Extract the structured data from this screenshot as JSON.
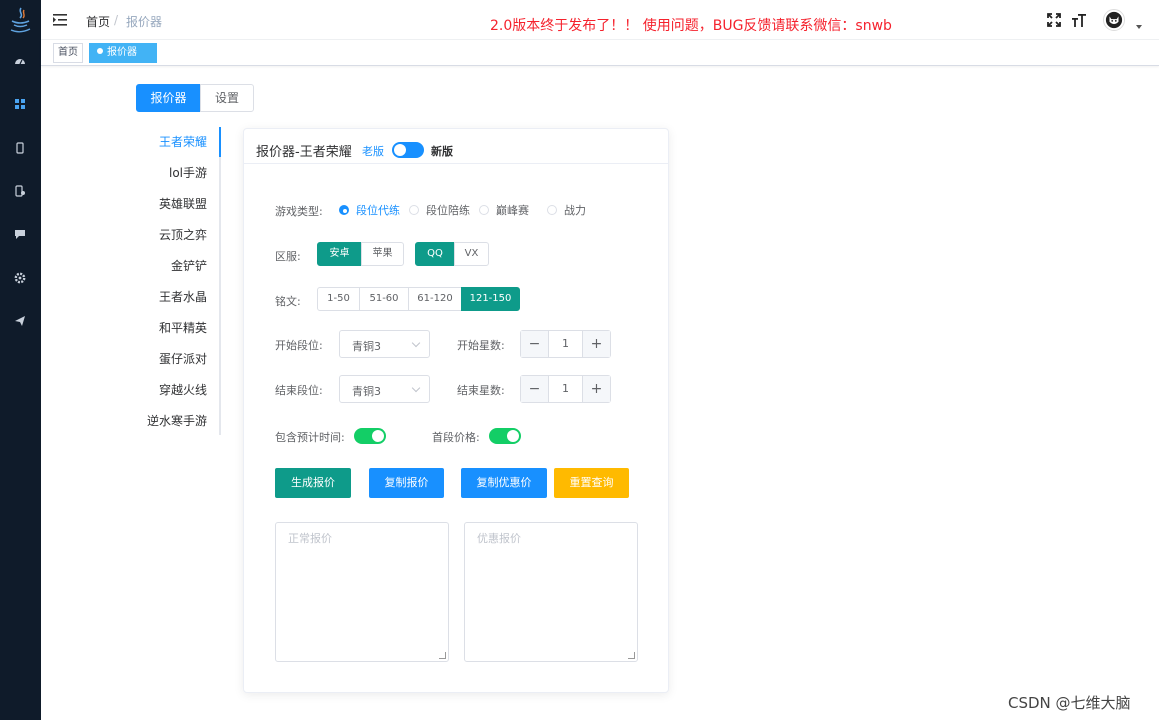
{
  "header": {
    "breadcrumb": [
      "首页",
      "/",
      "报价器"
    ],
    "announcement": "2.0版本终于发布了！！ 使用问题，BUG反馈请联系微信：snwb"
  },
  "sidebar": {
    "icons": [
      "dashboard-icon",
      "grid-icon",
      "mobile-icon",
      "mobile-tool-icon",
      "message-icon",
      "settings-icon",
      "send-icon"
    ]
  },
  "tags": {
    "home": "首页",
    "active": "报价器",
    "close": "×"
  },
  "top_tabs": [
    "报价器",
    "设置"
  ],
  "game_tabs": {
    "active_index": 0,
    "items": [
      "王者荣耀",
      "lol手游",
      "英雄联盟",
      "云顶之弈",
      "金铲铲",
      "王者水晶",
      "和平精英",
      "蛋仔派对",
      "穿越火线",
      "逆水寒手游"
    ]
  },
  "card": {
    "title": "报价器-王者荣耀",
    "old_label": "老版",
    "new_label": "新版"
  },
  "form": {
    "game_type_label": "游戏类型:",
    "game_types": [
      "段位代练",
      "段位陪练",
      "巅峰赛",
      "战力"
    ],
    "game_type_selected": 0,
    "region_label": "区服:",
    "platform": [
      "安卓",
      "苹果"
    ],
    "platform_selected": 0,
    "account": [
      "QQ",
      "VX"
    ],
    "account_selected": 0,
    "inscription_label": "铭文:",
    "inscriptions": [
      "1-50",
      "51-60",
      "61-120",
      "121-150"
    ],
    "inscription_selected": 3,
    "start_rank_label": "开始段位:",
    "start_rank_value": "青铜3",
    "start_stars_label": "开始星数:",
    "start_stars_value": "1",
    "end_rank_label": "结束段位:",
    "end_rank_value": "青铜3",
    "end_stars_label": "结束星数:",
    "end_stars_value": "1",
    "minus": "−",
    "plus": "+",
    "include_time_label": "包含预计时间:",
    "include_time_on": true,
    "first_price_label": "首段价格:",
    "first_price_on": true
  },
  "actions": {
    "generate": "生成报价",
    "copy": "复制报价",
    "copy_discount": "复制优惠价",
    "reset": "重置查询"
  },
  "colors": {
    "primary": "#1890ff",
    "teal": "#0e9b8a",
    "warning": "#ffba00",
    "switch_green": "#13ce66",
    "sidebar": "#0f1b2a",
    "announcement": "#f5222d"
  },
  "textareas": {
    "normal_placeholder": "正常报价",
    "discount_placeholder": "优惠报价"
  },
  "watermark": "CSDN @七维大脑"
}
